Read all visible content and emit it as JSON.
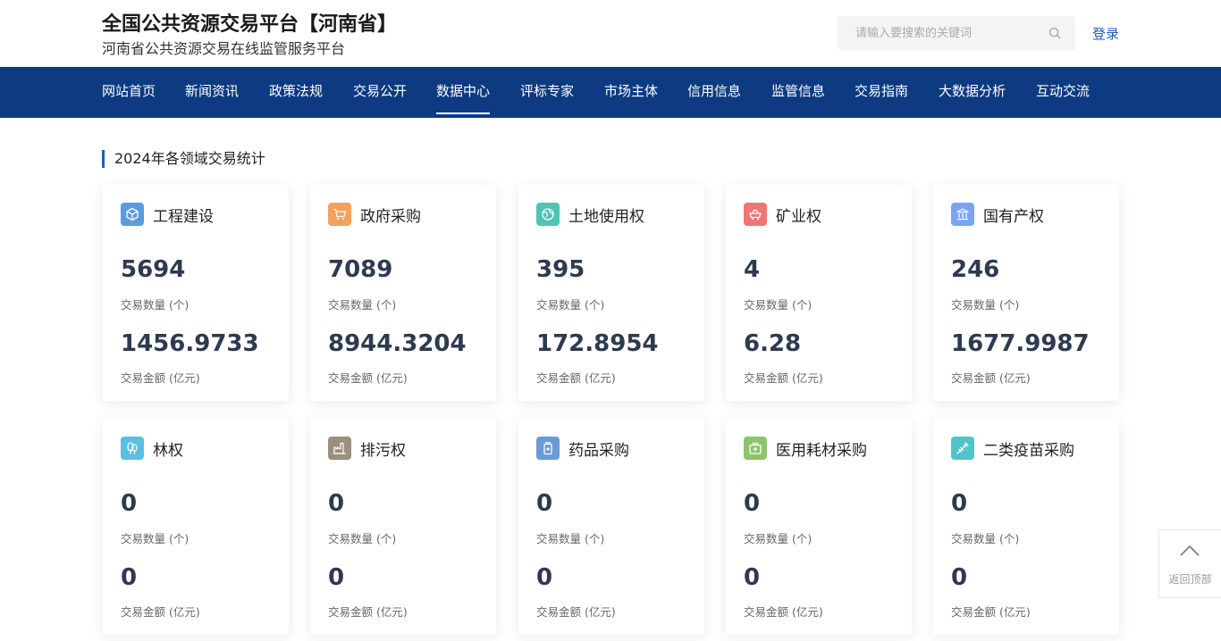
{
  "header": {
    "title": "全国公共资源交易平台【河南省】",
    "subtitle": "河南省公共资源交易在线监管服务平台",
    "search_placeholder": "请输入要搜索的关键词",
    "search_value": "",
    "login_label": "登录"
  },
  "nav": {
    "active": "数据中心",
    "items": [
      "网站首页",
      "新闻资讯",
      "政策法规",
      "交易公开",
      "数据中心",
      "评标专家",
      "市场主体",
      "信用信息",
      "监管信息",
      "交易指南",
      "大数据分析",
      "互动交流"
    ]
  },
  "section": {
    "title": "2024年各领域交易统计"
  },
  "cards": [
    {
      "name": "工程建设",
      "icon": "cube-icon",
      "color": "#5b9bde",
      "count": "5694",
      "count_label": "交易数量 (个)",
      "amount": "1456.9733",
      "amount_label": "交易金额 (亿元)"
    },
    {
      "name": "政府采购",
      "icon": "cart-icon",
      "color": "#f5a05c",
      "count": "7089",
      "count_label": "交易数量 (个)",
      "amount": "8944.3204",
      "amount_label": "交易金额 (亿元)"
    },
    {
      "name": "土地使用权",
      "icon": "globe-icon",
      "color": "#4fc4b2",
      "count": "395",
      "count_label": "交易数量 (个)",
      "amount": "172.8954",
      "amount_label": "交易金额 (亿元)"
    },
    {
      "name": "矿业权",
      "icon": "mining-cart-icon",
      "color": "#f07676",
      "count": "4",
      "count_label": "交易数量 (个)",
      "amount": "6.28",
      "amount_label": "交易金额 (亿元)"
    },
    {
      "name": "国有产权",
      "icon": "building-icon",
      "color": "#7aa4f2",
      "count": "246",
      "count_label": "交易数量 (个)",
      "amount": "1677.9987",
      "amount_label": "交易金额 (亿元)"
    },
    {
      "name": "林权",
      "icon": "tree-icon",
      "color": "#5bbfe0",
      "count": "0",
      "count_label": "交易数量 (个)",
      "amount": "0",
      "amount_label": "交易金额 (亿元)"
    },
    {
      "name": "排污权",
      "icon": "factory-icon",
      "color": "#9d8f7e",
      "count": "0",
      "count_label": "交易数量 (个)",
      "amount": "0",
      "amount_label": "交易金额 (亿元)"
    },
    {
      "name": "药品采购",
      "icon": "medicine-icon",
      "color": "#6b9ad6",
      "count": "0",
      "count_label": "交易数量 (个)",
      "amount": "0",
      "amount_label": "交易金额 (亿元)"
    },
    {
      "name": "医用耗材采购",
      "icon": "medkit-icon",
      "color": "#8cc46a",
      "count": "0",
      "count_label": "交易数量 (个)",
      "amount": "0",
      "amount_label": "交易金额 (亿元)"
    },
    {
      "name": "二类疫苗采购",
      "icon": "syringe-icon",
      "color": "#4fc4c9",
      "count": "0",
      "count_label": "交易数量 (个)",
      "amount": "0",
      "amount_label": "交易金额 (亿元)"
    }
  ],
  "back_to_top": {
    "label": "返回顶部"
  }
}
